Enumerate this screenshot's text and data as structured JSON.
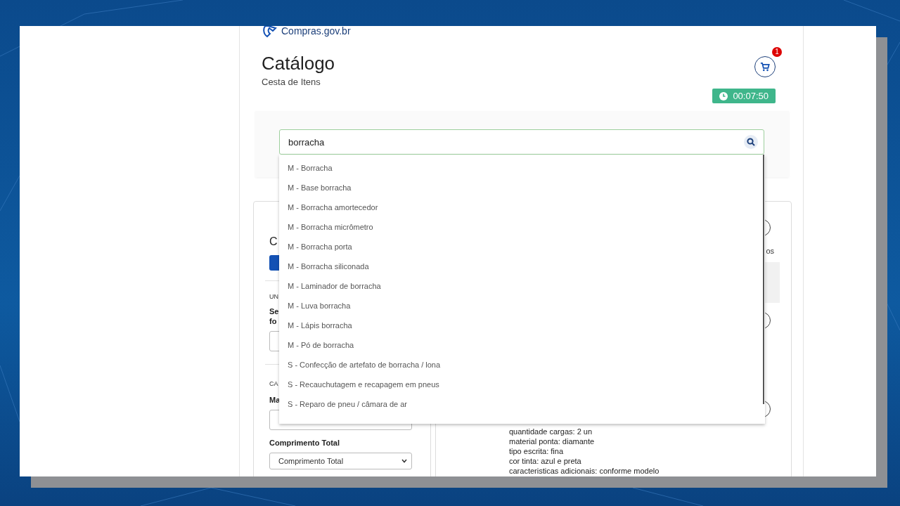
{
  "logo": {
    "text": "Compras.gov.br"
  },
  "page": {
    "title": "Catálogo",
    "subtitle": "Cesta de Itens"
  },
  "cart": {
    "count": "1"
  },
  "timer": "00:07:50",
  "search": {
    "value": "borracha"
  },
  "suggestions": [
    {
      "label": "M - Borracha",
      "selected": false
    },
    {
      "label": "M - Base borracha",
      "selected": false
    },
    {
      "label": "M - Borracha amortecedor",
      "selected": false
    },
    {
      "label": "M - Borracha micrômetro",
      "selected": false
    },
    {
      "label": "M - Borracha porta",
      "selected": false
    },
    {
      "label": "M - Borracha siliconada",
      "selected": false
    },
    {
      "label": "M - Laminador de borracha",
      "selected": false
    },
    {
      "label": "M - Luva borracha",
      "selected": false
    },
    {
      "label": "M - Lápis borracha",
      "selected": false
    },
    {
      "label": "M - Pó de borracha",
      "selected": false
    },
    {
      "label": "S - Confecção de artefato de borracha / lona",
      "selected": false
    },
    {
      "label": "S - Recauchutagem e recapagem em pneus",
      "selected": false
    },
    {
      "label": "S - Reparo de pneu / câmara de ar",
      "selected": false
    }
  ],
  "left_panel": {
    "heading": "C",
    "section_1": "UN",
    "field_label": [
      "Se",
      "fo"
    ],
    "section_2": "CA",
    "select_label": "Ma",
    "length_label": "Comprimento Total",
    "length_select": "Comprimento Total"
  },
  "right_panel": {
    "label": "os",
    "details": [
      "quantidade cargas: 2 un",
      "material ponta: diamante",
      "tipo escrita: fina",
      "cor tinta: azul e preta",
      "caracteristicas adicionais: conforme modelo"
    ]
  }
}
